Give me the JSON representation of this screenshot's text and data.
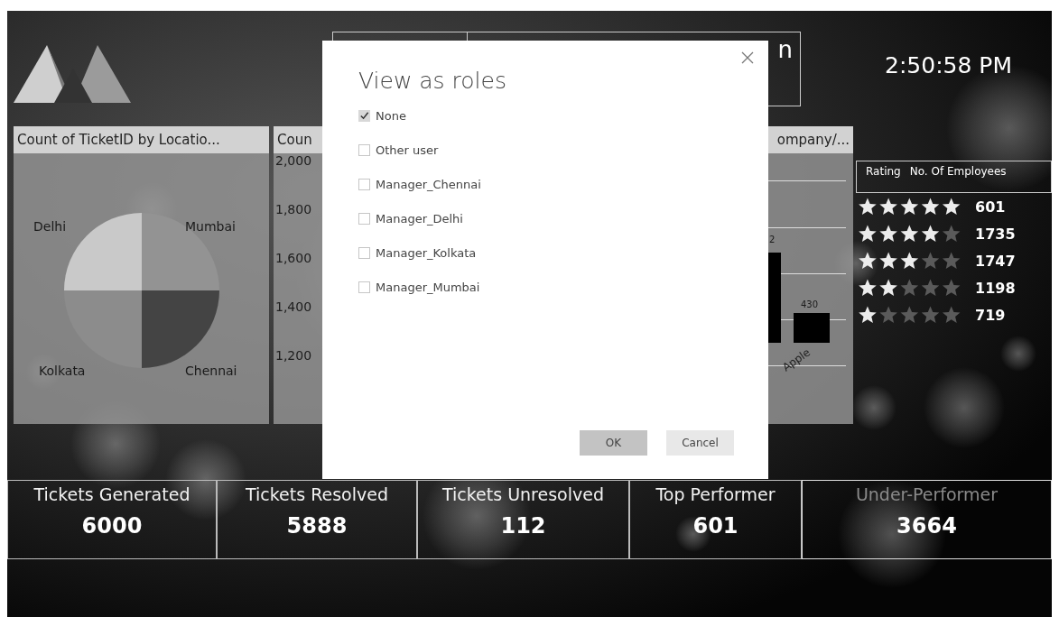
{
  "header": {
    "title_fragment": "n",
    "clock": "2:50:58 PM"
  },
  "pie_panel": {
    "title": "Count of TicketID by Locatio...",
    "slices": [
      {
        "label": "Delhi",
        "color": "#c9c9c9"
      },
      {
        "label": "Mumbai",
        "color": "#939393"
      },
      {
        "label": "Kolkata",
        "color": "#8c8c8c"
      },
      {
        "label": "Chennai",
        "color": "#444444"
      }
    ]
  },
  "axis_panel": {
    "title": "Coun",
    "yticks": [
      "2,000",
      "1,800",
      "1,600",
      "1,400",
      "1,200"
    ]
  },
  "bar_panel": {
    "title": "ompany/...",
    "bar_labels": [
      "2",
      "430"
    ],
    "category": "Apple"
  },
  "rating_panel": {
    "headers": [
      "Rating",
      "No. Of Employees"
    ],
    "rows": [
      {
        "stars": 5,
        "count": "601"
      },
      {
        "stars": 4,
        "count": "1735"
      },
      {
        "stars": 3,
        "count": "1747"
      },
      {
        "stars": 2,
        "count": "1198"
      },
      {
        "stars": 1,
        "count": "719"
      }
    ]
  },
  "cards": [
    {
      "label": "Tickets Generated",
      "value": "6000",
      "dimmed": false
    },
    {
      "label": "Tickets Resolved",
      "value": "5888",
      "dimmed": false
    },
    {
      "label": "Tickets Unresolved",
      "value": "112",
      "dimmed": false
    },
    {
      "label": "Top Performer",
      "value": "601",
      "dimmed": false
    },
    {
      "label": "Under-Performer",
      "value": "3664",
      "dimmed": true
    }
  ],
  "dialog": {
    "title": "View as roles",
    "options": [
      {
        "label": "None",
        "checked": true
      },
      {
        "label": "Other user",
        "checked": false
      },
      {
        "label": "Manager_Chennai",
        "checked": false
      },
      {
        "label": "Manager_Delhi",
        "checked": false
      },
      {
        "label": "Manager_Kolkata",
        "checked": false
      },
      {
        "label": "Manager_Mumbai",
        "checked": false
      }
    ],
    "buttons": [
      {
        "label": "OK",
        "kind": "primary"
      },
      {
        "label": "Cancel",
        "kind": "secondary"
      }
    ]
  }
}
